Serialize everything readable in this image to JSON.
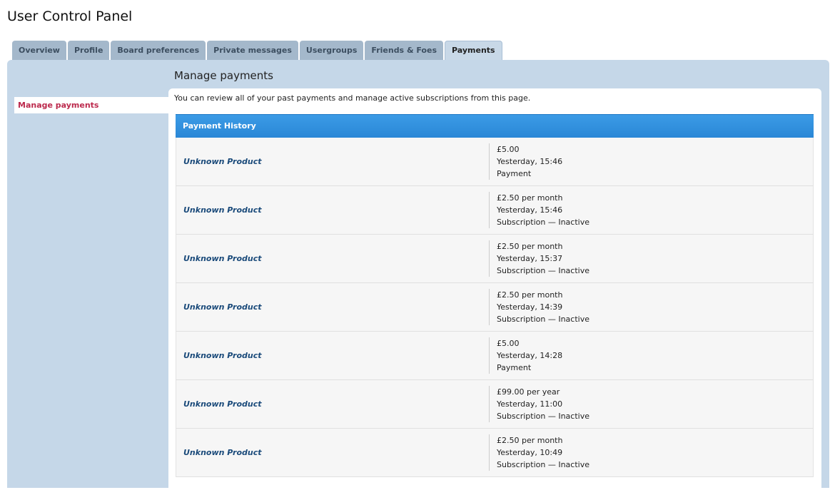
{
  "page": {
    "title": "User Control Panel"
  },
  "tabs": [
    {
      "label": "Overview",
      "active": false
    },
    {
      "label": "Profile",
      "active": false
    },
    {
      "label": "Board preferences",
      "active": false
    },
    {
      "label": "Private messages",
      "active": false
    },
    {
      "label": "Usergroups",
      "active": false
    },
    {
      "label": "Friends & Foes",
      "active": false
    },
    {
      "label": "Payments",
      "active": true
    }
  ],
  "sidebar": {
    "items": [
      {
        "label": "Manage payments",
        "active": true
      }
    ]
  },
  "main": {
    "heading": "Manage payments",
    "intro": "You can review all of your past payments and manage active subscriptions from this page.",
    "history_title": "Payment History",
    "rows": [
      {
        "product": "Unknown Product",
        "amount": "£5.00",
        "time": "Yesterday, 15:46",
        "type": "Payment"
      },
      {
        "product": "Unknown Product",
        "amount": "£2.50 per month",
        "time": "Yesterday, 15:46",
        "type": "Subscription — Inactive"
      },
      {
        "product": "Unknown Product",
        "amount": "£2.50 per month",
        "time": "Yesterday, 15:37",
        "type": "Subscription — Inactive"
      },
      {
        "product": "Unknown Product",
        "amount": "£2.50 per month",
        "time": "Yesterday, 14:39",
        "type": "Subscription — Inactive"
      },
      {
        "product": "Unknown Product",
        "amount": "£5.00",
        "time": "Yesterday, 14:28",
        "type": "Payment"
      },
      {
        "product": "Unknown Product",
        "amount": "£99.00 per year",
        "time": "Yesterday, 11:00",
        "type": "Subscription — Inactive"
      },
      {
        "product": "Unknown Product",
        "amount": "£2.50 per month",
        "time": "Yesterday, 10:49",
        "type": "Subscription — Inactive"
      }
    ]
  },
  "colors": {
    "tab_bg": "#a4b8cb",
    "tab_active_bg": "#c8d8e7",
    "panel_bg": "#c5d7e8",
    "header_blue": "#2a87d6",
    "sidebar_active_text": "#bc2a4d",
    "product_link": "#1a4a7a"
  }
}
